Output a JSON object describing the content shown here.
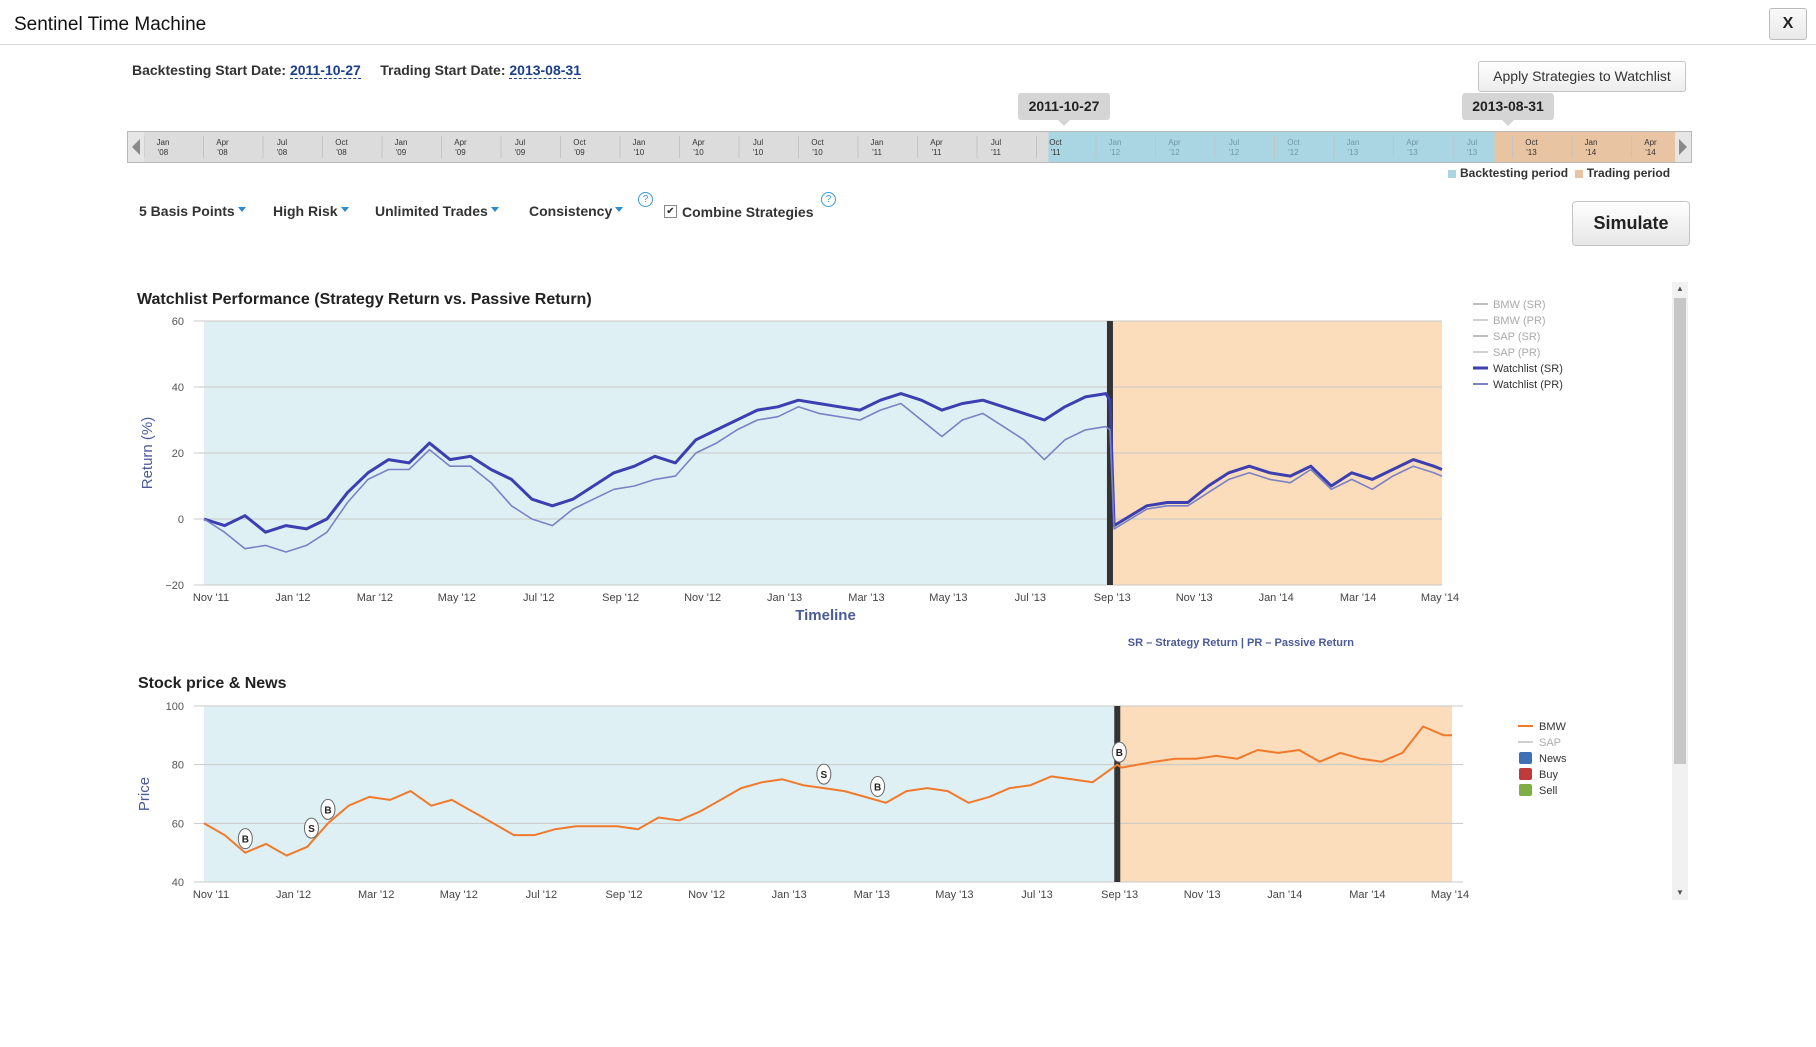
{
  "window": {
    "title": "Sentinel Time Machine",
    "close_label": "X"
  },
  "dates": {
    "backtesting_label": "Backtesting Start Date:",
    "backtesting_value": "2011-10-27",
    "trading_label": "Trading Start Date:",
    "trading_value": "2013-08-31"
  },
  "apply_button": "Apply Strategies to Watchlist",
  "markers": {
    "backtesting": "2011-10-27",
    "trading": "2013-08-31"
  },
  "timeline": {
    "ticks": [
      {
        "m": "Jan",
        "y": "'08"
      },
      {
        "m": "Apr",
        "y": "'08"
      },
      {
        "m": "Jul",
        "y": "'08"
      },
      {
        "m": "Oct",
        "y": "'08"
      },
      {
        "m": "Jan",
        "y": "'09"
      },
      {
        "m": "Apr",
        "y": "'09"
      },
      {
        "m": "Jul",
        "y": "'09"
      },
      {
        "m": "Oct",
        "y": "'09"
      },
      {
        "m": "Jan",
        "y": "'10"
      },
      {
        "m": "Apr",
        "y": "'10"
      },
      {
        "m": "Jul",
        "y": "'10"
      },
      {
        "m": "Oct",
        "y": "'10"
      },
      {
        "m": "Jan",
        "y": "'11"
      },
      {
        "m": "Apr",
        "y": "'11"
      },
      {
        "m": "Jul",
        "y": "'11"
      },
      {
        "m": "Oct",
        "y": "'11"
      },
      {
        "m": "Jan",
        "y": "'12"
      },
      {
        "m": "Apr",
        "y": "'12"
      },
      {
        "m": "Jul",
        "y": "'12"
      },
      {
        "m": "Oct",
        "y": "'12"
      },
      {
        "m": "Jan",
        "y": "'13"
      },
      {
        "m": "Apr",
        "y": "'13"
      },
      {
        "m": "Jul",
        "y": "'13"
      },
      {
        "m": "Oct",
        "y": "'13"
      },
      {
        "m": "Jan",
        "y": "'14"
      },
      {
        "m": "Apr",
        "y": "'14"
      }
    ],
    "backtesting_start_index": 15.2,
    "trading_start_index": 22.7,
    "legend": {
      "backtesting": "Backtesting period",
      "trading": "Trading period"
    }
  },
  "controls": {
    "transaction_cost": "5 Basis Points",
    "risk": "High Risk",
    "trades": "Unlimited Trades",
    "mode": "Consistency",
    "combine_label": "Combine Strategies",
    "combine_checked": true,
    "help": "?",
    "simulate": "Simulate"
  },
  "colors": {
    "backtest_bg": "#dff0f5",
    "trading_bg": "#fbdcbb",
    "timeline_backtest": "#a9d6e2",
    "timeline_trading": "#e8c4a2",
    "watchlist_sr": "#3b3fb0",
    "watchlist_pr": "#7a82c4",
    "bmw": "#f07a2c",
    "news": "#3f6fb5",
    "buy": "#c0393b",
    "sell": "#7fae47"
  },
  "chart_data": [
    {
      "type": "line",
      "title": "Watchlist Performance (Strategy Return vs. Passive Return)",
      "xlabel": "Timeline",
      "ylabel": "Return (%)",
      "ylim": [
        -20,
        60
      ],
      "yticks": [
        "60",
        "40",
        "20",
        "0",
        "−20"
      ],
      "xticks": [
        "Nov '11",
        "Jan '12",
        "Mar '12",
        "May '12",
        "Jul '12",
        "Sep '12",
        "Nov '12",
        "Jan '13",
        "Mar '13",
        "May '13",
        "Jul '13",
        "Sep '13",
        "Nov '13",
        "Jan '14",
        "Mar '14",
        "May '14"
      ],
      "xlim": [
        0,
        30.2
      ],
      "divider_x": 22.1,
      "footnote": "SR – Strategy Return | PR – Passive Return",
      "legend": [
        "BMW (SR)",
        "BMW (PR)",
        "SAP (SR)",
        "SAP (PR)",
        "Watchlist (SR)",
        "Watchlist (PR)"
      ],
      "legend_placement": "right",
      "series": [
        {
          "name": "Watchlist (SR)",
          "x": [
            0,
            0.5,
            1,
            1.5,
            2,
            2.5,
            3,
            3.5,
            4,
            4.5,
            5,
            5.5,
            6,
            6.5,
            7,
            7.5,
            8,
            8.5,
            9,
            9.5,
            10,
            10.5,
            11,
            11.5,
            12,
            12.5,
            13,
            13.5,
            14,
            14.5,
            15,
            15.5,
            16,
            16.5,
            17,
            17.5,
            18,
            18.5,
            19,
            19.5,
            20,
            20.5,
            21,
            21.5,
            22,
            22.1,
            22.2,
            23,
            23.5,
            24,
            24.5,
            25,
            25.5,
            26,
            26.5,
            27,
            27.5,
            28,
            28.5,
            29,
            29.5,
            30,
            30.2
          ],
          "values": [
            0,
            -2,
            1,
            -4,
            -2,
            -3,
            0,
            8,
            14,
            18,
            17,
            23,
            18,
            19,
            15,
            12,
            6,
            4,
            6,
            10,
            14,
            16,
            19,
            17,
            24,
            27,
            30,
            33,
            34,
            36,
            35,
            34,
            33,
            36,
            38,
            36,
            33,
            35,
            36,
            34,
            32,
            30,
            34,
            37,
            38,
            36,
            -2,
            4,
            5,
            5,
            10,
            14,
            16,
            14,
            13,
            16,
            10,
            14,
            12,
            15,
            18,
            16,
            15
          ]
        },
        {
          "name": "Watchlist (PR)",
          "x": [
            0,
            0.5,
            1,
            1.5,
            2,
            2.5,
            3,
            3.5,
            4,
            4.5,
            5,
            5.5,
            6,
            6.5,
            7,
            7.5,
            8,
            8.5,
            9,
            9.5,
            10,
            10.5,
            11,
            11.5,
            12,
            12.5,
            13,
            13.5,
            14,
            14.5,
            15,
            15.5,
            16,
            16.5,
            17,
            17.5,
            18,
            18.5,
            19,
            19.5,
            20,
            20.5,
            21,
            21.5,
            22,
            22.1,
            22.2,
            23,
            23.5,
            24,
            24.5,
            25,
            25.5,
            26,
            26.5,
            27,
            27.5,
            28,
            28.5,
            29,
            29.5,
            30,
            30.2
          ],
          "values": [
            0,
            -4,
            -9,
            -8,
            -10,
            -8,
            -4,
            5,
            12,
            15,
            15,
            21,
            16,
            16,
            11,
            4,
            0,
            -2,
            3,
            6,
            9,
            10,
            12,
            13,
            20,
            23,
            27,
            30,
            31,
            34,
            32,
            31,
            30,
            33,
            35,
            30,
            25,
            30,
            32,
            28,
            24,
            18,
            24,
            27,
            28,
            27,
            -3,
            3,
            4,
            4,
            8,
            12,
            14,
            12,
            11,
            15,
            9,
            12,
            9,
            13,
            16,
            14,
            13
          ]
        }
      ]
    },
    {
      "type": "line",
      "title": "Stock price & News",
      "ylabel": "Price",
      "ylim": [
        40,
        100
      ],
      "yticks": [
        "100",
        "80",
        "60",
        "40"
      ],
      "xticks": [
        "Nov '11",
        "Jan '12",
        "Mar '12",
        "May '12",
        "Jul '12",
        "Sep '12",
        "Nov '12",
        "Jan '13",
        "Mar '13",
        "May '13",
        "Jul '13",
        "Sep '13",
        "Nov '13",
        "Jan '14",
        "Mar '14",
        "May '14"
      ],
      "xlim": [
        0,
        30.2
      ],
      "divider_x": 22.1,
      "legend": [
        "BMW",
        "SAP",
        "News",
        "Buy",
        "Sell"
      ],
      "legend_placement": "right",
      "series": [
        {
          "name": "BMW",
          "x": [
            0,
            0.5,
            1,
            1.5,
            2,
            2.5,
            3,
            3.5,
            4,
            4.5,
            5,
            5.5,
            6,
            6.5,
            7,
            7.5,
            8,
            8.5,
            9,
            9.5,
            10,
            10.5,
            11,
            11.5,
            12,
            12.5,
            13,
            13.5,
            14,
            14.5,
            15,
            15.5,
            16,
            16.5,
            17,
            17.5,
            18,
            18.5,
            19,
            19.5,
            20,
            20.5,
            21,
            21.5,
            22,
            22.1,
            22.2,
            23,
            23.5,
            24,
            24.5,
            25,
            25.5,
            26,
            26.5,
            27,
            27.5,
            28,
            28.5,
            29,
            29.5,
            30,
            30.2
          ],
          "values": [
            60,
            56,
            50,
            53,
            49,
            52,
            60,
            66,
            69,
            68,
            71,
            66,
            68,
            64,
            60,
            56,
            56,
            58,
            59,
            59,
            59,
            58,
            62,
            61,
            64,
            68,
            72,
            74,
            75,
            73,
            72,
            71,
            69,
            67,
            71,
            72,
            71,
            67,
            69,
            72,
            73,
            76,
            75,
            74,
            79,
            80,
            79,
            81,
            82,
            82,
            83,
            82,
            85,
            84,
            85,
            81,
            84,
            82,
            81,
            84,
            93,
            90,
            90
          ]
        }
      ],
      "markers": [
        {
          "label": "B",
          "type": "Buy",
          "x": 1
        },
        {
          "label": "S",
          "type": "Sell",
          "x": 2.6
        },
        {
          "label": "B",
          "type": "Buy",
          "x": 3
        },
        {
          "label": "S",
          "type": "Sell",
          "x": 15
        },
        {
          "label": "B",
          "type": "Buy",
          "x": 16.3
        },
        {
          "label": "B",
          "type": "Buy",
          "x": 22.15
        }
      ]
    }
  ]
}
